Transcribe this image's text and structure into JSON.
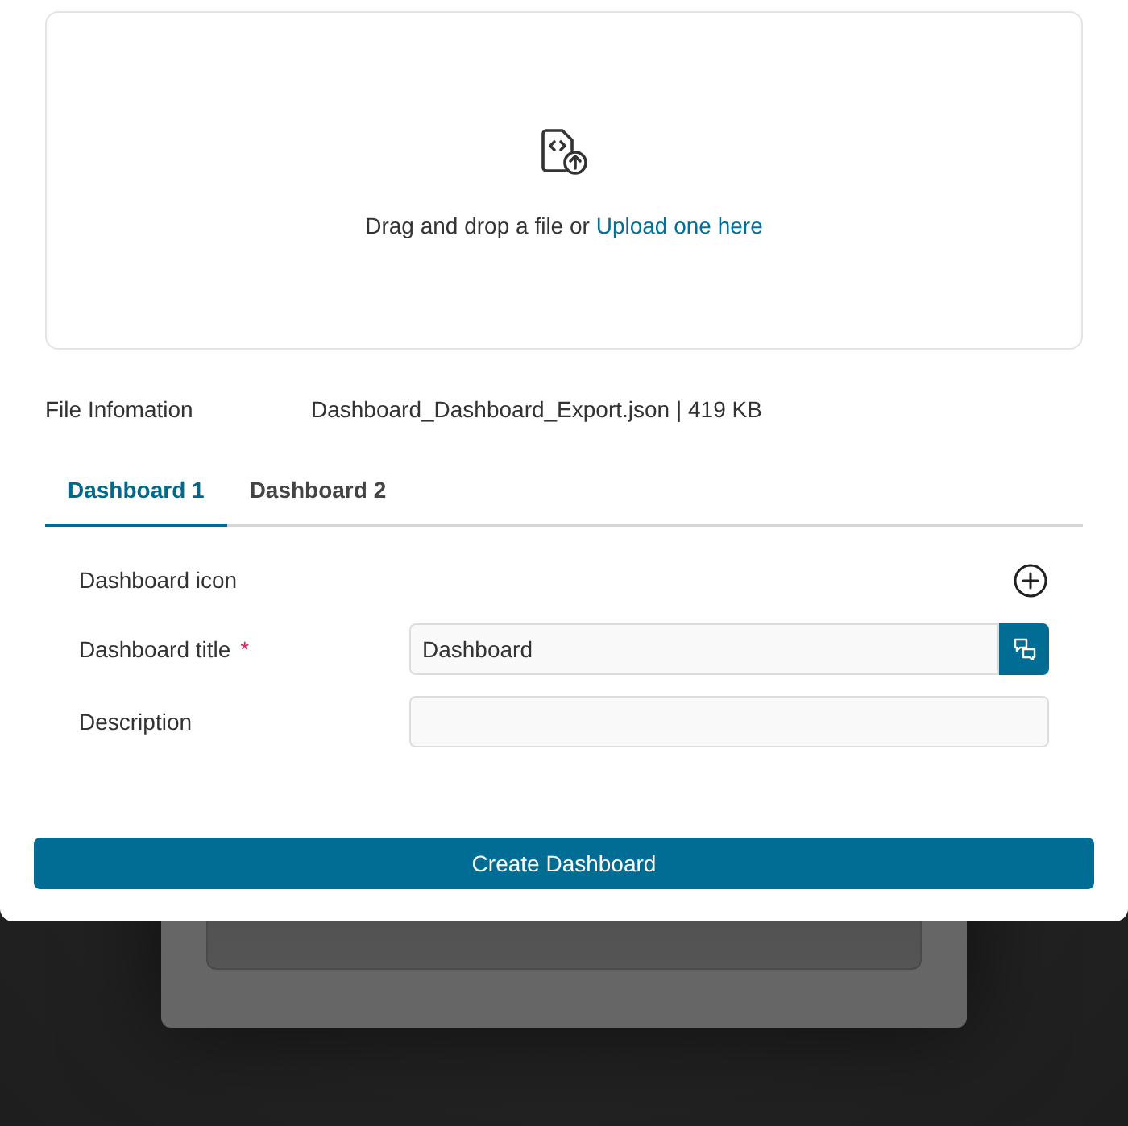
{
  "upload": {
    "prompt": "Drag and drop a file or",
    "link": "Upload one here"
  },
  "file_info": {
    "label": "File Infomation",
    "value": "Dashboard_Dashboard_Export.json | 419 KB"
  },
  "tabs": [
    {
      "label": "Dashboard 1",
      "selected": true
    },
    {
      "label": "Dashboard 2",
      "selected": false
    }
  ],
  "form": {
    "fields": [
      {
        "kind": "icon",
        "label": "Dashboard icon"
      },
      {
        "kind": "text",
        "label": "Dashboard title",
        "required_mark": "*",
        "value": "Dashboard",
        "translatable": true
      },
      {
        "kind": "text",
        "label": "Description",
        "translatable": false
      }
    ]
  },
  "action": {
    "label": "Create Dashboard"
  }
}
